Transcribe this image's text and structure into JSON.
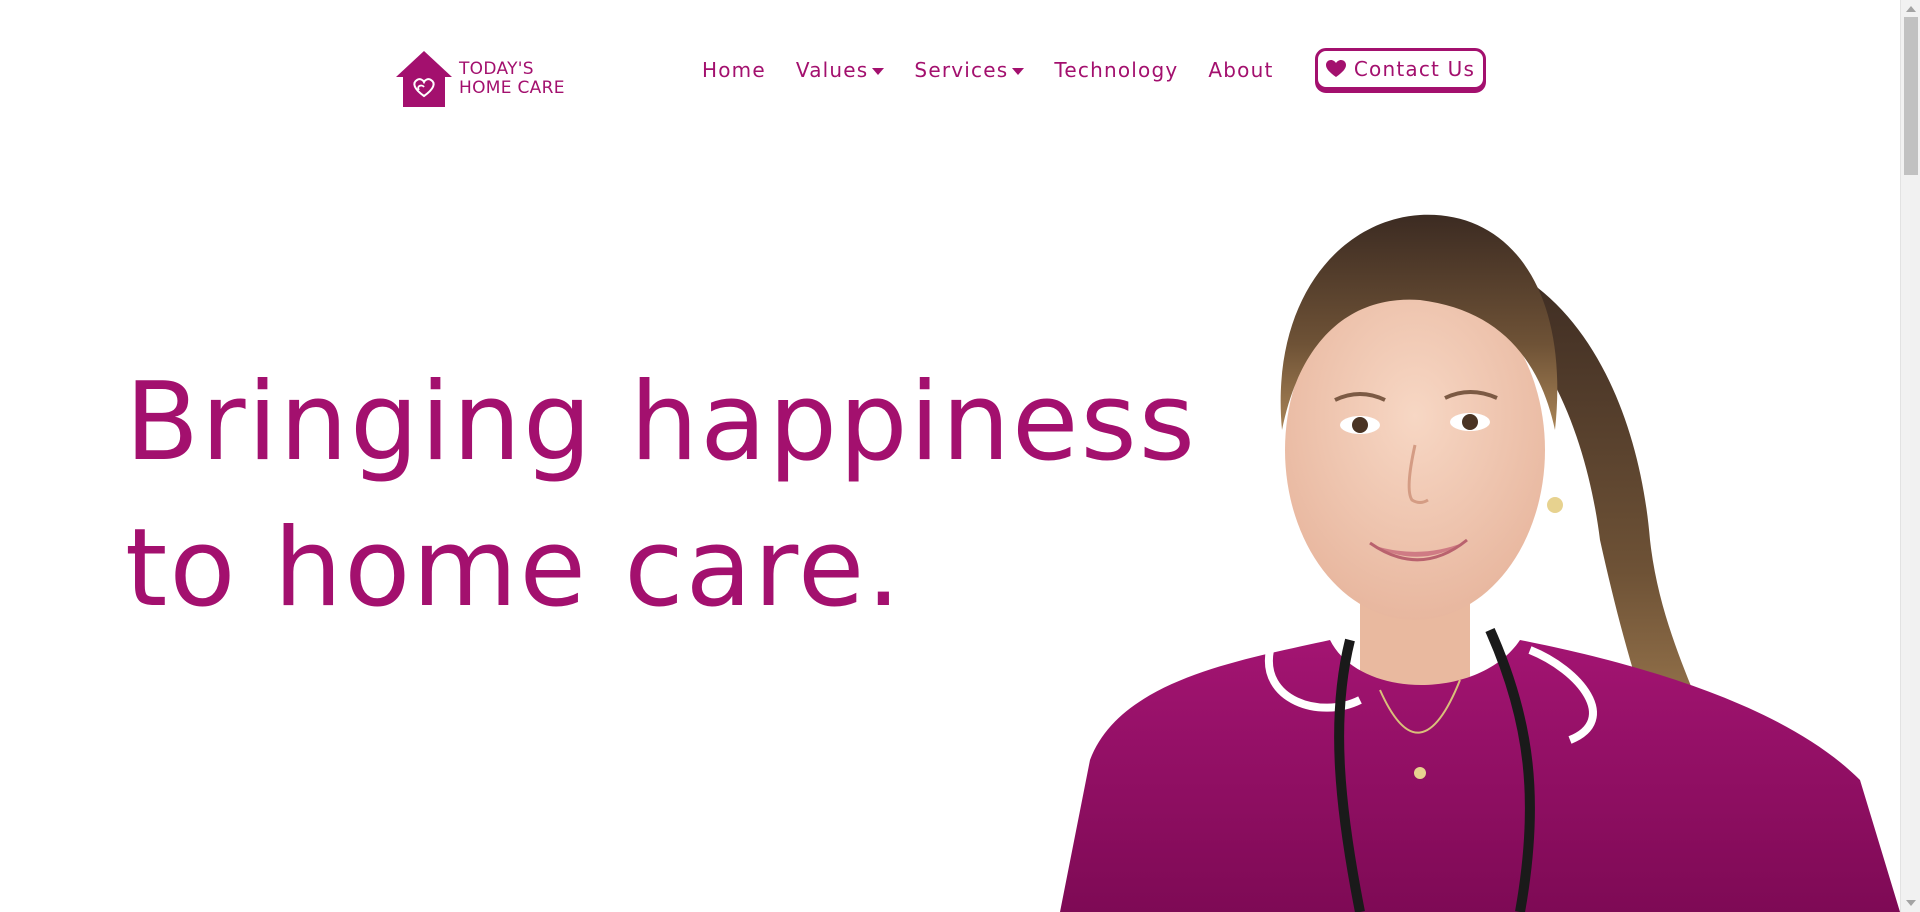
{
  "brand": {
    "line1": "TODAY'S",
    "line2": "HOME CARE",
    "logo_icon": "house-heart-icon",
    "color": "#a3106e"
  },
  "nav": {
    "items": [
      {
        "label": "Home",
        "dropdown": false
      },
      {
        "label": "Values",
        "dropdown": true
      },
      {
        "label": "Services",
        "dropdown": true
      },
      {
        "label": "Technology",
        "dropdown": false
      },
      {
        "label": "About",
        "dropdown": false
      }
    ],
    "contact": {
      "label": "Contact Us",
      "icon": "heart-icon"
    }
  },
  "hero": {
    "line1": "Bringing happiness",
    "line2": "to home care.",
    "image": "smiling-nurse-photo"
  },
  "colors": {
    "accent": "#a3106e",
    "background": "#ffffff",
    "uniform": "#9c0f6a"
  }
}
